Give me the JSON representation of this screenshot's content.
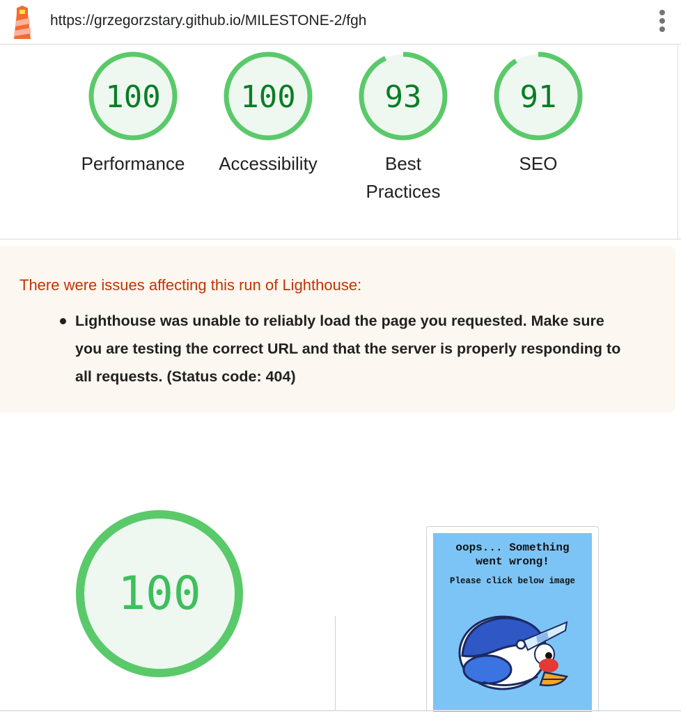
{
  "topbar": {
    "url": "https://grzegorzstary.github.io/MILESTONE-2/fgh",
    "menu_icon": "kebab-menu-icon",
    "logo_icon": "lighthouse-logo-icon"
  },
  "categories": [
    {
      "score": "100",
      "value": 100,
      "label": "Performance"
    },
    {
      "score": "100",
      "value": 100,
      "label": "Accessibility"
    },
    {
      "score": "93",
      "value": 93,
      "label_line1": "Best",
      "label_line2": "Practices"
    },
    {
      "score": "91",
      "value": 91,
      "label": "SEO"
    }
  ],
  "warning": {
    "title": "There were issues affecting this run of Lighthouse:",
    "items": [
      "Lighthouse was unable to reliably load the page you requested. Make sure you are testing the correct URL and that the server is properly responding to all requests. (Status code: 404)"
    ]
  },
  "performance_gauge": {
    "score": "100",
    "value": 100
  },
  "screenshot": {
    "line1": "oops... Something",
    "line2": "went wrong!",
    "line3": "Please click below image"
  },
  "colors": {
    "pass": "#0cce6b",
    "pass_ring": "#5ac96a",
    "pass_fill": "#eef8f0",
    "score_text": "#0a7d26",
    "warning_text": "#c33300",
    "warning_bg": "#fdf7f1",
    "thumb_bg": "#7cc4f5"
  }
}
